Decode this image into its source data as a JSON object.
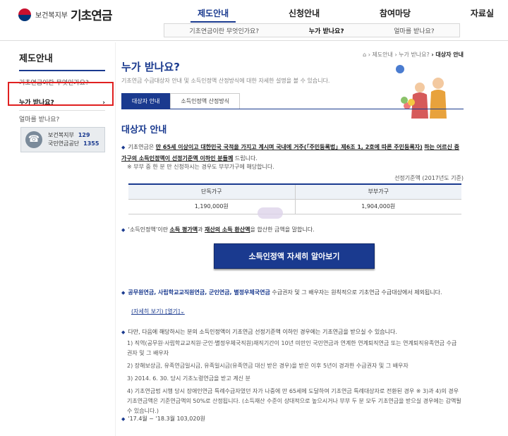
{
  "header": {
    "ministry": "보건복지부",
    "service": "기초연금",
    "gnb": [
      "제도안내",
      "신청안내",
      "참여마당",
      "자료실"
    ],
    "subnav": [
      "기초연금이란 무엇인가요?",
      "누가 받나요?",
      "얼마를 받나요?"
    ]
  },
  "lnb": {
    "title": "제도안내",
    "items": [
      "기초연금이란 무엇인가요?",
      "누가 받나요?",
      "얼마를 받나요?"
    ],
    "active_arrow": "›"
  },
  "contact": {
    "line1_name": "보건복지부",
    "line1_num": "129",
    "line2_name": "국민연금공단",
    "line2_num": "1355"
  },
  "main": {
    "breadcrumb_home": "⌂",
    "breadcrumb_1": "› 제도안내",
    "breadcrumb_2": "› 누가 받나요?",
    "breadcrumb_3": "› 대상자 안내",
    "title": "누가 받나요?",
    "desc": "기초연금 수급대상자 안내 및 소득인정액 산정방식에 대한 자세한 설명을 볼 수 있습니다.",
    "tabs": [
      "대상자 안내",
      "소득인정액 산정방식"
    ],
    "section_title": "대상자 안내",
    "p1_a": "기초연금은 ",
    "p1_u1": "만 65세 이상이고 대한민국 국적을 가지고 계시며 국내에 거주(「주민등록법」제6조 1, 2호에 따른 주민등록자)",
    "p1_b": " ",
    "p1_u2": "하는 어르신 중 가구의 소득인정액이 선정기준액 이하인 분들께",
    "p1_c": " 드립니다.",
    "sub_note": "※ 부부 중 한 분 만 신청하시는 경우도 부부가구에 해당합니다.",
    "std_note": "선정기준액 (2017년도 기준)",
    "table_headers": [
      "단독가구",
      "부부가구"
    ],
    "table_values": [
      "1,190,000원",
      "1,904,000원"
    ],
    "p2_a": "‘소득인정액’이란 ",
    "p2_u1": "소득 평가액",
    "p2_b": "과 ",
    "p2_u2": "재산의 소득 환산액",
    "p2_c": "을 합산한 금액을 말합니다.",
    "cta": "소득인정액 자세히 알아보기",
    "p3_bold": "공무원연금, 사립학교교직원연금, 군인연금, 별정우체국연금",
    "p3_rest": " 수급권자 및 그 배우자는 원칙적으로 기초연금 수급대상에서 제외됩니다.",
    "link": "(자세히 보기) [열기]⌄",
    "p4": "다만, 다음에 해당하시는 분의 소득인정액이 기초연금 선정기준액 이하인 경우에는 기초연금을 받으실 수 있습니다.",
    "list": [
      "1) 직역(공무원·사립학교교직원·군인·별정우체국직원)재직기간이 10년 미만인 국민연금과 연계한 연계퇴직연금 또는 연계퇴직유족연금 수급권자 및 그 배우자",
      "2) 장해보상금, 유족연금일시금, 유족일시금(유족연금 대신 받은 경우)을 받은 이후 5년이 경과한 수급권자 및 그 배우자",
      "3) 2014. 6. 30. 당시 기초노령연금을 받고 계신 분",
      "4) 기초연금법 시행 당시 장애인연금 특례수급자였던 자가 나중에 만 65세에 도달하여 기초연금 특례대상자로 전환된 경우 ※ 3)과 4)의 경우 기초연금액은 기준연금액의 50%로 산정됩니다. (소득재산 수준이 상대적으로 높으시거나 부부 두 분 모두 기초연금을 받으실 경우에는 감액될 수 있습니다.)"
    ],
    "p5": "'17.4월 ~ '18.3월 103,020원"
  },
  "colors": {
    "accent": "#1a3a8f",
    "highlight_box": "#e02020"
  }
}
